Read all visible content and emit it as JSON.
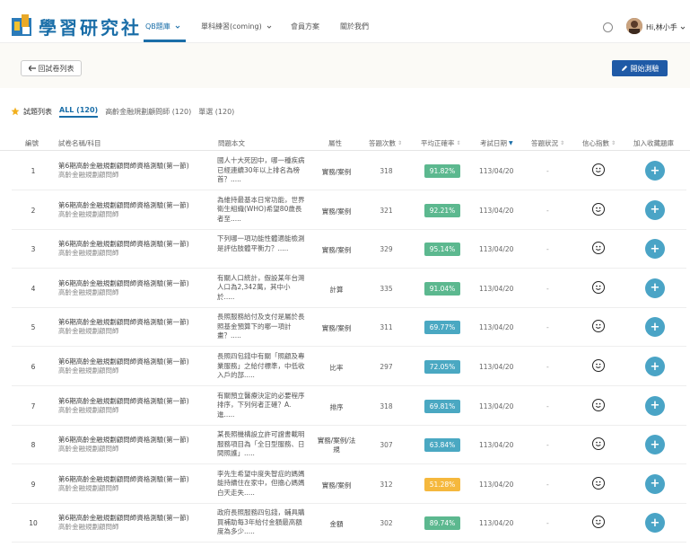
{
  "header": {
    "logo_text": "學習研究社",
    "nav": [
      {
        "label": "QB題庫",
        "has_caret": true,
        "active": true
      },
      {
        "label": "單科練習(coming)",
        "has_caret": true,
        "active": false
      },
      {
        "label": "會員方案",
        "has_caret": false,
        "active": false
      },
      {
        "label": "關於我們",
        "has_caret": false,
        "active": false
      }
    ],
    "user_name": "Hi,林小手",
    "brand_color": "#1a6ea8"
  },
  "toolbar": {
    "back_label": "回試卷列表",
    "start_label": "開始測驗"
  },
  "tabs": {
    "title": "試題列表",
    "items": [
      {
        "label": "ALL (120)",
        "active": true
      },
      {
        "label": "高齡金融規劃顧問師 (120)",
        "active": false
      },
      {
        "label": "單選 (120)",
        "active": false
      }
    ]
  },
  "table": {
    "headers": [
      "編號",
      "試卷名稱/科目",
      "問題本文",
      "屬性",
      "答題次數",
      "平均正確率",
      "考試日期",
      "答題狀況",
      "信心指數",
      "加入收藏題庫"
    ],
    "rows": [
      {
        "no": "1",
        "name": "第6期高齡金融規劃顧問師資格測驗(第一節)",
        "subject": "高齡金融規劃顧問師",
        "question": "國人十大死因中，哪一種疾病已經連續30年以上排名為榜首？.....",
        "attr": "實務/案例",
        "count": "318",
        "rate": "91.82%",
        "rate_color": "#5cb88f",
        "date": "113/04/20",
        "status": "-"
      },
      {
        "no": "2",
        "name": "第6期高齡金融規劃顧問師資格測驗(第一節)",
        "subject": "高齡金融規劃顧問師",
        "question": "為維持最基本日常功能，世界衛生組織(WHO)希望80歲長者至.....",
        "attr": "實務/案例",
        "count": "321",
        "rate": "92.21%",
        "rate_color": "#5cb88f",
        "date": "113/04/20",
        "status": "-"
      },
      {
        "no": "3",
        "name": "第6期高齡金融規劃顧問師資格測驗(第一節)",
        "subject": "高齡金融規劃顧問師",
        "question": "下列哪一項功能性體適能檢測是評估肢體平衡力？.....",
        "attr": "實務/案例",
        "count": "329",
        "rate": "95.14%",
        "rate_color": "#5cb88f",
        "date": "113/04/20",
        "status": "-"
      },
      {
        "no": "4",
        "name": "第6期高齡金融規劃顧問師資格測驗(第一節)",
        "subject": "高齡金融規劃顧問師",
        "question": "有關人口統計，假設某年台灣人口為2,342萬，其中小於.....",
        "attr": "計算",
        "count": "335",
        "rate": "91.04%",
        "rate_color": "#5cb88f",
        "date": "113/04/20",
        "status": "-"
      },
      {
        "no": "5",
        "name": "第6期高齡金融規劃顧問師資格測驗(第一節)",
        "subject": "高齡金融規劃顧問師",
        "question": "長照服務給付及支付是屬於長照基金預算下的哪一項計畫？.....",
        "attr": "實務/案例",
        "count": "311",
        "rate": "69.77%",
        "rate_color": "#4aa8c2",
        "date": "113/04/20",
        "status": "-"
      },
      {
        "no": "6",
        "name": "第6期高齡金融規劃顧問師資格測驗(第一節)",
        "subject": "高齡金融規劃顧問師",
        "question": "長照四包錢中有關「照顧及專業服務」之給付標準，中低收入戶的部.....",
        "attr": "比率",
        "count": "297",
        "rate": "72.05%",
        "rate_color": "#4aa8c2",
        "date": "113/04/20",
        "status": "-"
      },
      {
        "no": "7",
        "name": "第6期高齡金融規劃顧問師資格測驗(第一節)",
        "subject": "高齡金融規劃顧問師",
        "question": "有關預立醫療決定的必要程序排序，下列何者正確？A.進.....",
        "attr": "排序",
        "count": "318",
        "rate": "69.81%",
        "rate_color": "#4aa8c2",
        "date": "113/04/20",
        "status": "-"
      },
      {
        "no": "8",
        "name": "第6期高齡金融規劃顧問師資格測驗(第一節)",
        "subject": "高齡金融規劃顧問師",
        "question": "某長照機構設立許可證書載明服務項目為「全日型服務、日間照護」.....",
        "attr": "實務/案例/法規",
        "count": "307",
        "rate": "63.84%",
        "rate_color": "#4aa8c2",
        "date": "113/04/20",
        "status": "-"
      },
      {
        "no": "9",
        "name": "第6期高齡金融規劃顧問師資格測驗(第一節)",
        "subject": "高齡金融規劃顧問師",
        "question": "李先生希望中度失智症的媽媽能持續住在家中，但擔心媽媽白天走失.....",
        "attr": "實務/案例",
        "count": "312",
        "rate": "51.28%",
        "rate_color": "#f5b83d",
        "date": "113/04/20",
        "status": "-"
      },
      {
        "no": "10",
        "name": "第6期高齡金融規劃顧問師資格測驗(第一節)",
        "subject": "高齡金融規劃顧問師",
        "question": "政府長照服務四包錢，輔具購買補助每3年給付金額最高額度為多少.....",
        "attr": "金額",
        "count": "302",
        "rate": "89.74%",
        "rate_color": "#5cb88f",
        "date": "113/04/20",
        "status": "-"
      }
    ]
  }
}
